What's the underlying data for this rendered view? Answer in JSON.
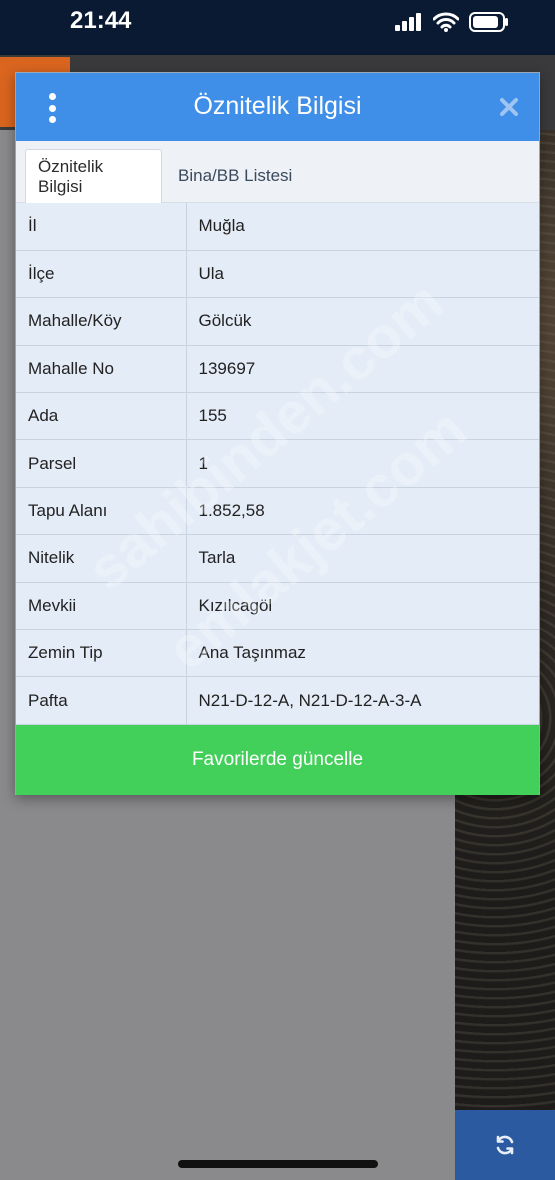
{
  "status_bar": {
    "time": "21:44"
  },
  "dialog": {
    "title": "Öznitelik Bilgisi",
    "tabs": [
      {
        "label": "Öznitelik Bilgisi",
        "active": true
      },
      {
        "label": "Bina/BB Listesi",
        "active": false
      }
    ],
    "rows": [
      {
        "key": "İl",
        "value": "Muğla"
      },
      {
        "key": "İlçe",
        "value": "Ula"
      },
      {
        "key": "Mahalle/Köy",
        "value": "Gölcük"
      },
      {
        "key": "Mahalle No",
        "value": "139697"
      },
      {
        "key": "Ada",
        "value": "155"
      },
      {
        "key": "Parsel",
        "value": "1"
      },
      {
        "key": "Tapu Alanı",
        "value": "1.852,58"
      },
      {
        "key": "Nitelik",
        "value": "Tarla"
      },
      {
        "key": "Mevkii",
        "value": "Kızılcagöl"
      },
      {
        "key": "Zemin Tip",
        "value": "Ana Taşınmaz"
      },
      {
        "key": "Pafta",
        "value": "N21-D-12-A, N21-D-12-A-3-A"
      }
    ],
    "update_button_label": "Favorilerde güncelle"
  },
  "watermarks": [
    "sahibinden.com",
    "emlakjet.com"
  ],
  "colors": {
    "header": "#3f8fe8",
    "update_button": "#42d05a",
    "table_bg": "#e4ecf7"
  },
  "icons": [
    "signal-icon",
    "wifi-icon",
    "battery-icon",
    "menu-dots-icon",
    "close-icon",
    "refresh-icon"
  ]
}
